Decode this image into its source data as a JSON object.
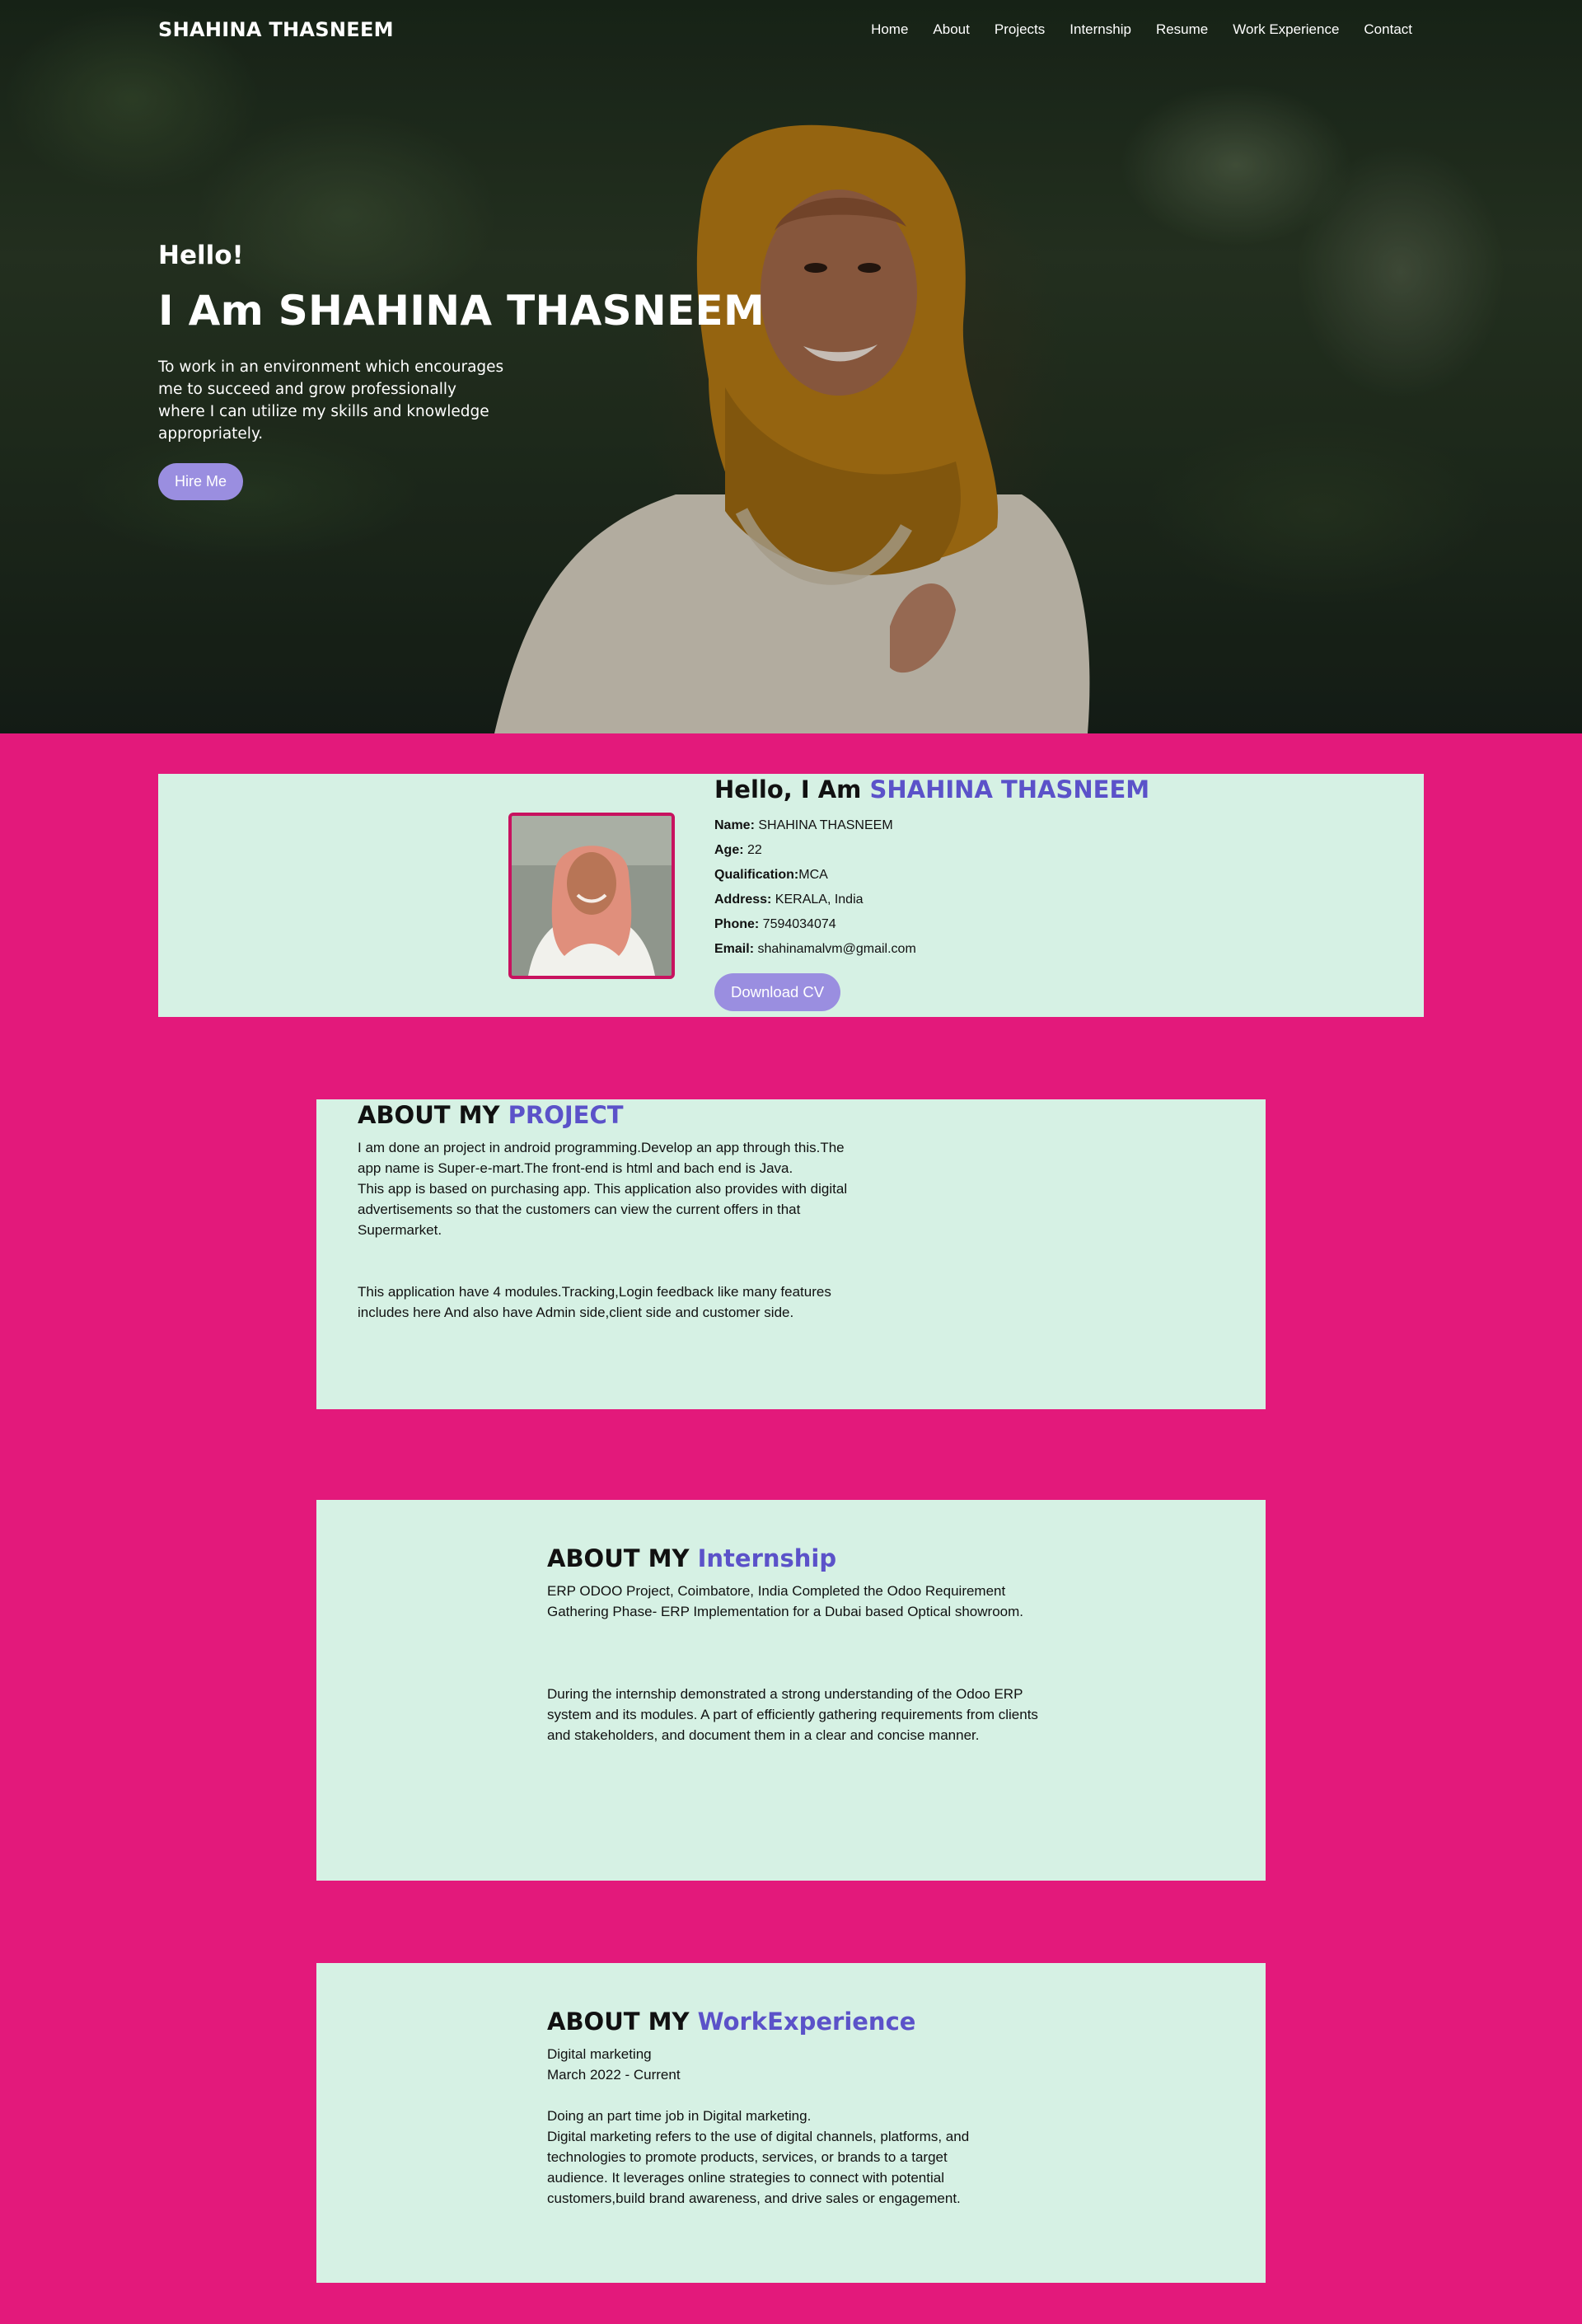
{
  "nav": {
    "brand": "SHAHINA THASNEEM",
    "items": [
      "Home",
      "About",
      "Projects",
      "Internship",
      "Resume",
      "Work Experience",
      "Contact"
    ]
  },
  "hero": {
    "hello": "Hello!",
    "title": "I Am SHAHINA THASNEEM",
    "description": "To work in an environment which encourages me to succeed and grow professionally where I can utilize my skills and knowledge appropriately.",
    "button": "Hire Me"
  },
  "profile": {
    "heading_prefix": "Hello, I Am",
    "heading_name": "SHAHINA THASNEEM",
    "fields": [
      {
        "label": "Name:",
        "value": " SHAHINA THASNEEM"
      },
      {
        "label": "Age:",
        "value": " 22"
      },
      {
        "label": "Qualification:",
        "value": "MCA"
      },
      {
        "label": "Address:",
        "value": " KERALA, India"
      },
      {
        "label": "Phone:",
        "value": " 7594034074"
      },
      {
        "label": "Email:",
        "value": " shahinamalvm@gmail.com"
      }
    ],
    "button": "Download CV"
  },
  "project": {
    "heading_prefix": "ABOUT MY",
    "heading_accent": "PROJECT",
    "para1": "I am done an project in android programming.Develop an app through this.The app name is Super-e-mart.The front-end is html and bach end is Java.",
    "para2": "This app is based on purchasing app. This application also provides with digital advertisements so that the customers can view the current offers in that Supermarket.",
    "para3": "This application have 4 modules.Tracking,Login feedback like many features includes here And also have Admin side,client side and customer side."
  },
  "internship": {
    "heading_prefix": "ABOUT MY",
    "heading_accent": "Internship",
    "para1": "ERP ODOO Project, Coimbatore, India Completed the Odoo Requirement Gathering Phase- ERP Implementation for a Dubai based Optical showroom.",
    "para2": "During the internship demonstrated a strong understanding of the Odoo ERP system and its modules. A part of efficiently gathering requirements from clients and stakeholders, and document them in a clear and concise manner."
  },
  "work": {
    "heading_prefix": "ABOUT MY",
    "heading_accent": "WorkExperience",
    "role": "Digital marketing",
    "period": "March 2022 - Current",
    "para1": "Doing an part time job in Digital marketing.",
    "para2": "Digital marketing refers to the use of digital channels, platforms, and technologies to promote products, services, or brands to a target audience. It leverages online strategies to connect with potential customers,build brand awareness, and drive sales or engagement."
  },
  "colors": {
    "page_background": "#e3197b",
    "card_background": "#d6f1e4",
    "accent_text": "#5b52c9",
    "button": "#9a8ee0"
  }
}
